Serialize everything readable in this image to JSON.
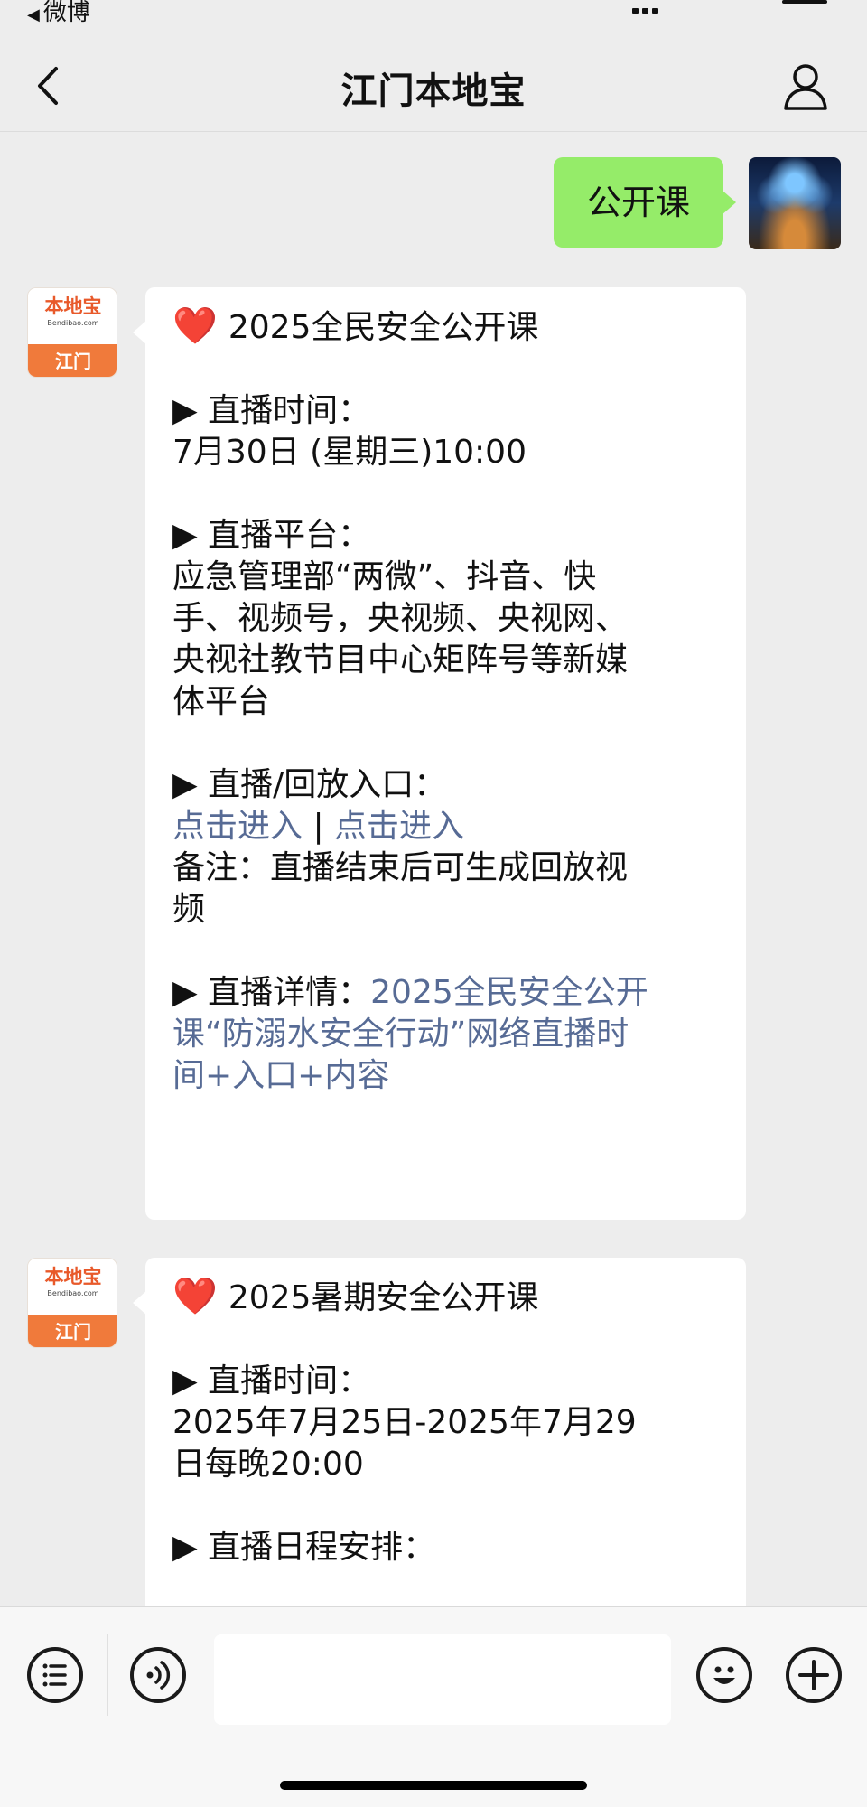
{
  "status_bar": {
    "back_app_label": "微博",
    "back_arrow": "◀"
  },
  "nav": {
    "title": "江门本地宝",
    "back_icon": "chevron-left-icon",
    "profile_icon": "person-outline-icon"
  },
  "sent_message": {
    "text": "公开课"
  },
  "bot_avatar": {
    "logo_text": "本地宝",
    "logo_sub": "Bendibao.com",
    "city": "江门"
  },
  "messages": [
    {
      "heading_icon": "❤️",
      "heading": "2025全民安全公开课",
      "broadcast_time_label": "▶ 直播时间：",
      "broadcast_time": "7月30日 (星期三)10:00",
      "platform_label": "▶ 直播平台：",
      "platform_lines": [
        "应急管理部“两微”、抖音、快",
        "手、视频号，央视频、央视网、",
        "央视社教节目中心矩阵号等新媒",
        "体平台"
      ],
      "entry_label": "▶ 直播/回放入口：",
      "entry_link_1": "点击进入",
      "entry_separator": " | ",
      "entry_link_2": "点击进入",
      "note_lines": [
        "备注：直播结束后可生成回放视",
        "频"
      ],
      "details_label": "▶ 直播详情：",
      "details_link_lines": [
        "2025全民安全公开",
        "课“防溺水安全行动”网络直播时",
        "间+入口+内容"
      ]
    },
    {
      "heading_icon": "❤️",
      "heading": "2025暑期安全公开课",
      "broadcast_time_label": "▶ 直播时间：",
      "broadcast_time_lines": [
        "2025年7月25日-2025年7月29",
        "日每晚20:00"
      ],
      "schedule_label": "▶ 直播日程安排："
    }
  ],
  "input_bar": {
    "placeholder": "",
    "menu_icon": "list-menu-icon",
    "voice_icon": "voice-icon",
    "emoji_icon": "emoji-icon",
    "plus_icon": "plus-icon"
  },
  "colors": {
    "sent_bubble": "#95ec69",
    "link": "#576b95",
    "background": "#ededed",
    "brand_orange": "#f07a3b"
  }
}
